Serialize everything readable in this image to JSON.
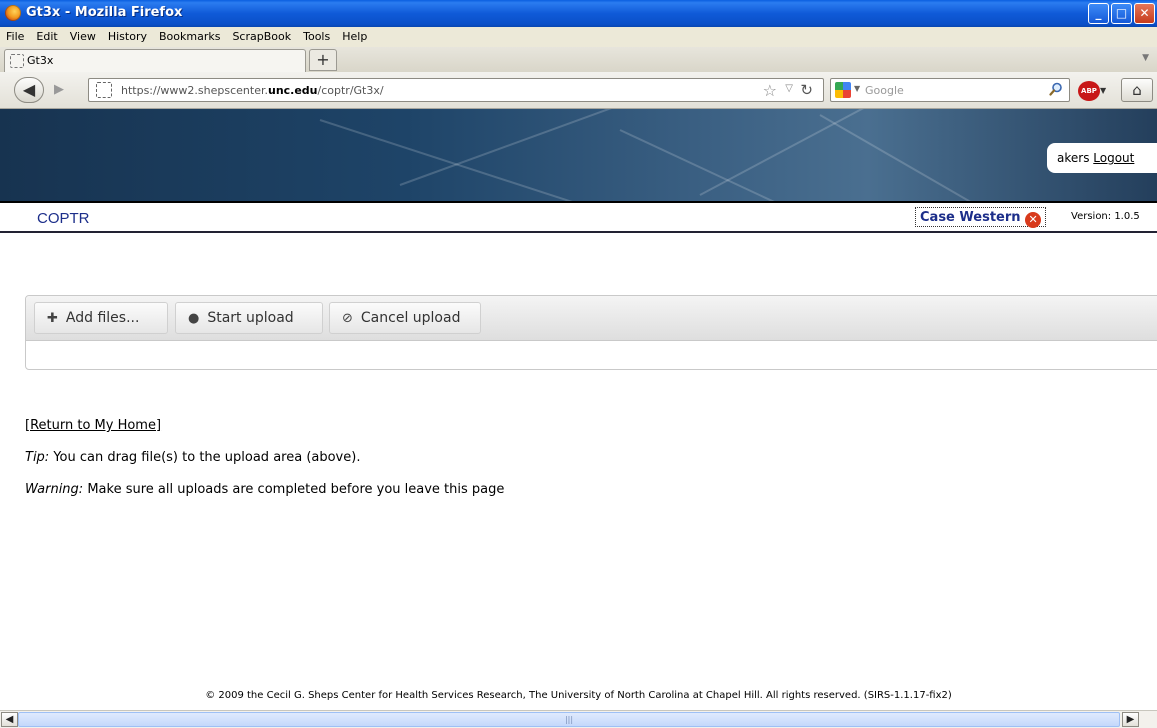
{
  "window": {
    "title": "Gt3x - Mozilla Firefox",
    "controls": {
      "minimize": "_",
      "maximize": "□",
      "close": "✕"
    }
  },
  "menu": [
    "File",
    "Edit",
    "View",
    "History",
    "Bookmarks",
    "ScrapBook",
    "Tools",
    "Help"
  ],
  "tab": {
    "title": "Gt3x",
    "new_tab_label": "+"
  },
  "navigation": {
    "url_prefix": "https://www2.shepscenter.",
    "url_domain": "unc.edu",
    "url_suffix": "/coptr/Gt3x/",
    "search_placeholder": "Google",
    "abp_label": "ABP"
  },
  "header": {
    "username": "akers",
    "logout_label": "Logout",
    "app_name": "COPTR",
    "organization": "Case Western",
    "version": "Version: 1.0.5"
  },
  "upload": {
    "add_files_label": "Add files...",
    "start_upload_label": "Start upload",
    "cancel_upload_label": "Cancel upload"
  },
  "content": {
    "return_link": "[Return to My Home]",
    "tip_label": "Tip:",
    "tip_text": " You can drag file(s) to the upload area (above).",
    "warning_label": "Warning:",
    "warning_text": " Make sure all uploads are completed before you leave this page"
  },
  "footer": {
    "text": "© 2009 the Cecil G. Sheps Center for Health Services Research, The University of North Carolina at Chapel Hill. All rights reserved. (SIRS-1.1.17-fix2)"
  },
  "colors": {
    "titlebar": "#0a5fe0",
    "banner": "#1e4468",
    "app_name": "#1c2e8a",
    "close_badge": "#d83a1c"
  }
}
